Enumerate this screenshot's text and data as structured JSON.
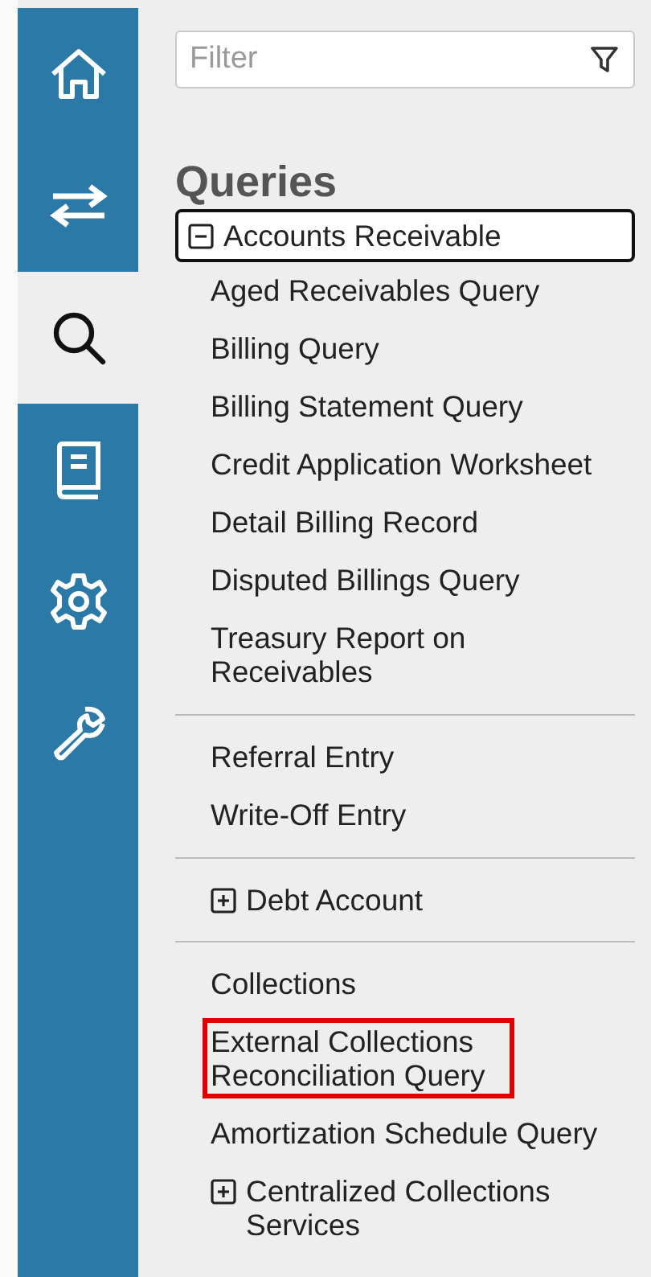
{
  "nav": [
    {
      "kind": "home",
      "selected": false
    },
    {
      "kind": "transfer",
      "selected": false
    },
    {
      "kind": "search",
      "selected": true
    },
    {
      "kind": "book",
      "selected": false
    },
    {
      "kind": "settings",
      "selected": false
    },
    {
      "kind": "wrench",
      "selected": false
    }
  ],
  "filter": {
    "placeholder": "Filter"
  },
  "heading": "Queries",
  "sections": [
    {
      "items": [
        {
          "kind": "group",
          "label": "Accounts Receivable",
          "expanded": true,
          "focused": true
        },
        {
          "kind": "link",
          "label": "Aged Receivables Query",
          "highlighted": false
        },
        {
          "kind": "link",
          "label": "Billing Query",
          "highlighted": false
        },
        {
          "kind": "link",
          "label": "Billing Statement Query",
          "highlighted": false
        },
        {
          "kind": "link",
          "label": "Credit Application Worksheet",
          "highlighted": false
        },
        {
          "kind": "link",
          "label": "Detail Billing Record",
          "highlighted": false
        },
        {
          "kind": "link",
          "label": "Disputed Billings Query",
          "highlighted": false
        },
        {
          "kind": "link",
          "label": "Treasury Report on Receivables",
          "highlighted": false
        }
      ]
    },
    {
      "items": [
        {
          "kind": "link",
          "label": "Referral Entry",
          "highlighted": false
        },
        {
          "kind": "link",
          "label": "Write-Off Entry",
          "highlighted": false
        }
      ]
    },
    {
      "items": [
        {
          "kind": "group",
          "label": "Debt Account",
          "expanded": false,
          "focused": false
        }
      ]
    },
    {
      "items": [
        {
          "kind": "link",
          "label": "Collections",
          "highlighted": false
        },
        {
          "kind": "link",
          "label": "External Collections Reconciliation Query",
          "highlighted": true
        },
        {
          "kind": "link",
          "label": "Amortization Schedule Query",
          "highlighted": false
        },
        {
          "kind": "group",
          "label": "Centralized Collections Services",
          "expanded": false,
          "focused": false
        }
      ]
    }
  ]
}
